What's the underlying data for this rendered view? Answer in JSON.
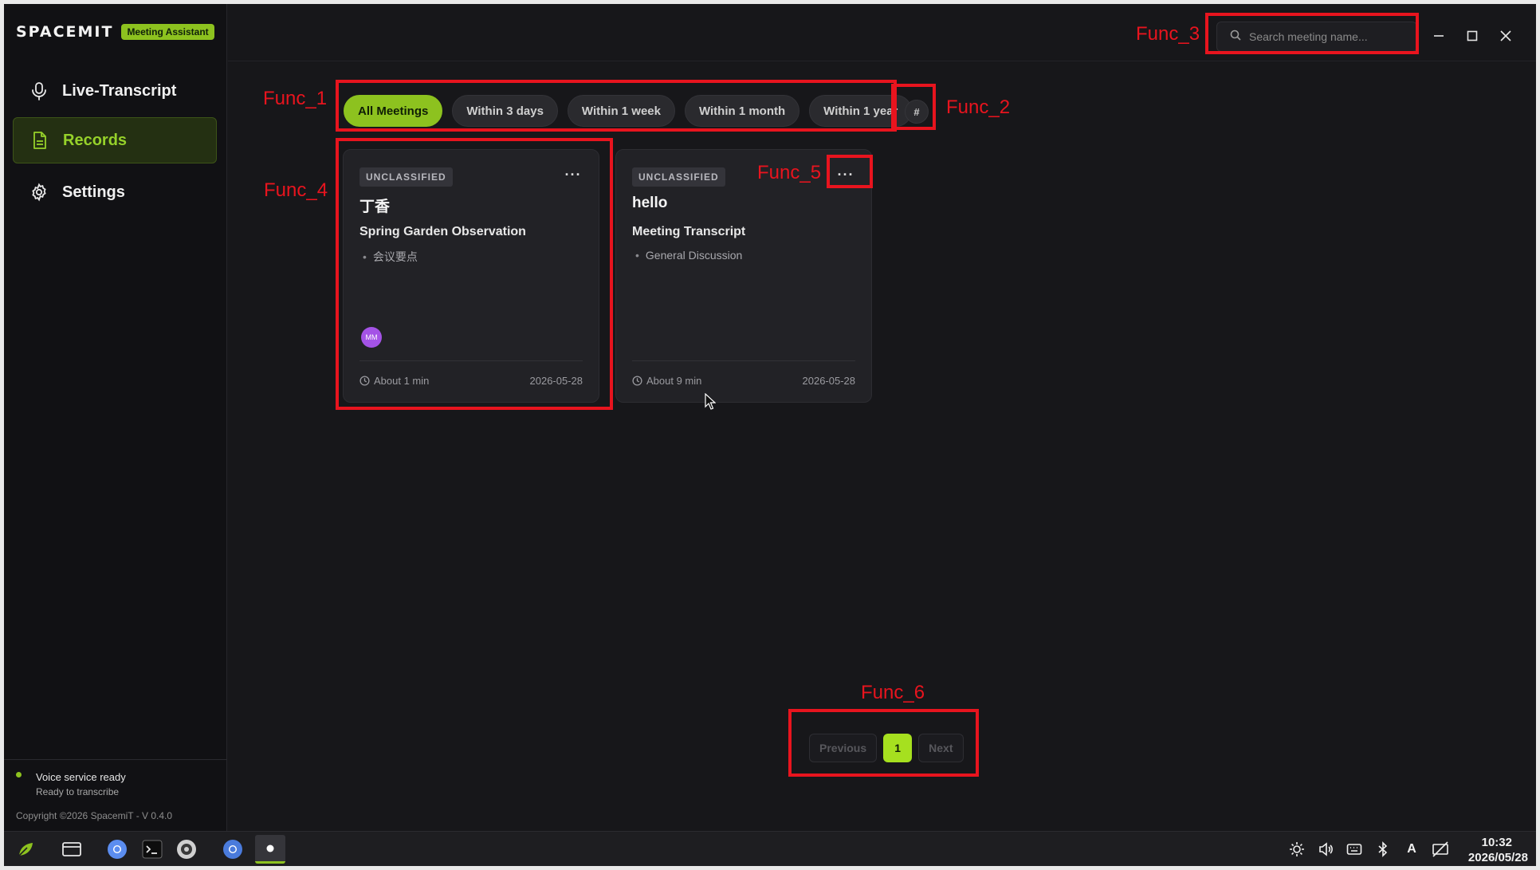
{
  "brand": {
    "logo": "SPACEMIT",
    "badge": "Meeting Assistant"
  },
  "sidebar": {
    "items": [
      {
        "label": "Live-Transcript",
        "icon": "microphone-icon",
        "active": false
      },
      {
        "label": "Records",
        "icon": "document-icon",
        "active": true
      },
      {
        "label": "Settings",
        "icon": "gear-icon",
        "active": false
      }
    ],
    "status": {
      "title": "Voice service ready",
      "subtitle": "Ready to transcribe"
    },
    "copyright": "Copyright ©2026 SpacemiT - V 0.4.0"
  },
  "search": {
    "placeholder": "Search meeting name..."
  },
  "filters": {
    "chips": [
      "All Meetings",
      "Within 3 days",
      "Within 1 week",
      "Within 1 month",
      "Within 1 year"
    ],
    "active_index": 0,
    "tag_button": "#"
  },
  "cards": [
    {
      "badge": "UNCLASSIFIED",
      "title": "丁香",
      "subtitle": "Spring Garden Observation",
      "point": "会议要点",
      "avatar": "MM",
      "duration": "About 1 min",
      "date": "2026-05-28"
    },
    {
      "badge": "UNCLASSIFIED",
      "title": "hello",
      "subtitle": "Meeting Transcript",
      "point": "General Discussion",
      "duration": "About 9 min",
      "date": "2026-05-28"
    }
  ],
  "pagination": {
    "previous": "Previous",
    "page": "1",
    "next": "Next"
  },
  "annotations": {
    "func_1": "Func_1",
    "func_2": "Func_2",
    "func_3": "Func_3",
    "func_4": "Func_4",
    "func_5": "Func_5",
    "func_6": "Func_6"
  },
  "taskbar": {
    "time": "10:32",
    "date": "2026/05/28",
    "input_method": "A"
  },
  "colors": {
    "accent": "#8dc21f",
    "annotation": "#e8141e",
    "background": "#17171a"
  }
}
